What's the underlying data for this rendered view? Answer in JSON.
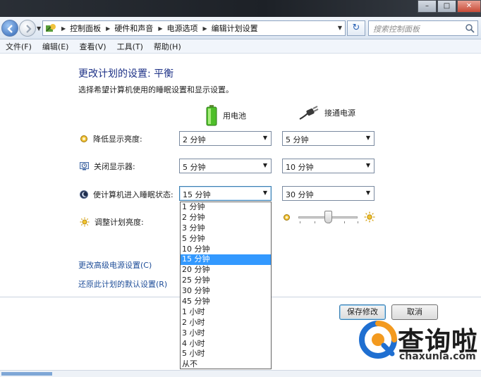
{
  "address_bar": {
    "crumbs": [
      "控制面板",
      "硬件和声音",
      "电源选项",
      "编辑计划设置"
    ],
    "search_placeholder": "搜索控制面板"
  },
  "menu": [
    "文件(F)",
    "编辑(E)",
    "查看(V)",
    "工具(T)",
    "帮助(H)"
  ],
  "page": {
    "title": "更改计划的设置: 平衡",
    "subtitle": "选择希望计算机使用的睡眠设置和显示设置。"
  },
  "columns": {
    "battery": "用电池",
    "plugged": "接通电源"
  },
  "settings": [
    {
      "label": "降低显示亮度:",
      "battery": "2 分钟",
      "plugged": "5 分钟"
    },
    {
      "label": "关闭显示器:",
      "battery": "5 分钟",
      "plugged": "10 分钟"
    },
    {
      "label": "使计算机进入睡眠状态:",
      "battery": "15 分钟",
      "plugged": "30 分钟"
    }
  ],
  "brightness": {
    "label": "调整计划亮度:",
    "plugged_level": 0.5
  },
  "dropdown_options": [
    "1 分钟",
    "2 分钟",
    "3 分钟",
    "5 分钟",
    "10 分钟",
    "15 分钟",
    "20 分钟",
    "25 分钟",
    "30 分钟",
    "45 分钟",
    "1 小时",
    "2 小时",
    "3 小时",
    "4 小时",
    "5 小时",
    "从不"
  ],
  "dropdown_selected": "15 分钟",
  "links": {
    "advanced": "更改高级电源设置(C)",
    "restore": "还原此计划的默认设置(R)"
  },
  "buttons": {
    "save": "保存修改",
    "cancel": "取消"
  },
  "watermark": {
    "brand": "查询啦",
    "domain": "chaxunla.com"
  },
  "colors": {
    "title_blue": "#1e3287",
    "link_blue": "#1f4e99",
    "selection": "#3399ff",
    "watermark_orange": "#f39a1f",
    "watermark_blue": "#1f6fd1"
  }
}
